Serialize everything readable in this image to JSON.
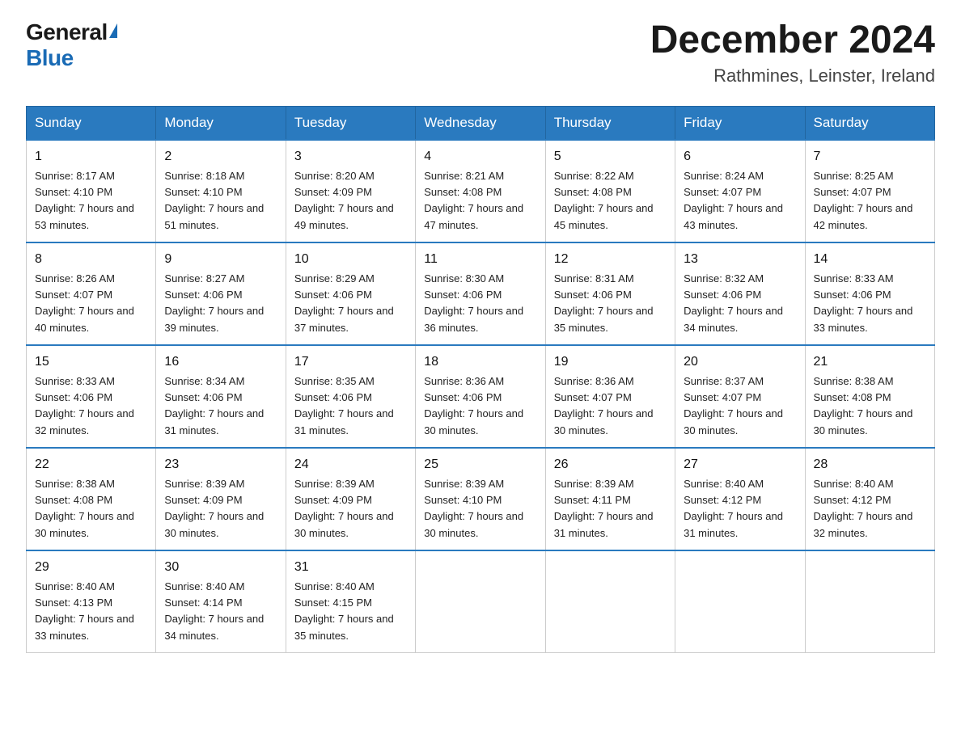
{
  "header": {
    "logo_general": "General",
    "logo_blue": "Blue",
    "month_title": "December 2024",
    "subtitle": "Rathmines, Leinster, Ireland"
  },
  "calendar": {
    "days_of_week": [
      "Sunday",
      "Monday",
      "Tuesday",
      "Wednesday",
      "Thursday",
      "Friday",
      "Saturday"
    ],
    "weeks": [
      [
        {
          "day": "1",
          "sunrise": "8:17 AM",
          "sunset": "4:10 PM",
          "daylight": "7 hours and 53 minutes."
        },
        {
          "day": "2",
          "sunrise": "8:18 AM",
          "sunset": "4:10 PM",
          "daylight": "7 hours and 51 minutes."
        },
        {
          "day": "3",
          "sunrise": "8:20 AM",
          "sunset": "4:09 PM",
          "daylight": "7 hours and 49 minutes."
        },
        {
          "day": "4",
          "sunrise": "8:21 AM",
          "sunset": "4:08 PM",
          "daylight": "7 hours and 47 minutes."
        },
        {
          "day": "5",
          "sunrise": "8:22 AM",
          "sunset": "4:08 PM",
          "daylight": "7 hours and 45 minutes."
        },
        {
          "day": "6",
          "sunrise": "8:24 AM",
          "sunset": "4:07 PM",
          "daylight": "7 hours and 43 minutes."
        },
        {
          "day": "7",
          "sunrise": "8:25 AM",
          "sunset": "4:07 PM",
          "daylight": "7 hours and 42 minutes."
        }
      ],
      [
        {
          "day": "8",
          "sunrise": "8:26 AM",
          "sunset": "4:07 PM",
          "daylight": "7 hours and 40 minutes."
        },
        {
          "day": "9",
          "sunrise": "8:27 AM",
          "sunset": "4:06 PM",
          "daylight": "7 hours and 39 minutes."
        },
        {
          "day": "10",
          "sunrise": "8:29 AM",
          "sunset": "4:06 PM",
          "daylight": "7 hours and 37 minutes."
        },
        {
          "day": "11",
          "sunrise": "8:30 AM",
          "sunset": "4:06 PM",
          "daylight": "7 hours and 36 minutes."
        },
        {
          "day": "12",
          "sunrise": "8:31 AM",
          "sunset": "4:06 PM",
          "daylight": "7 hours and 35 minutes."
        },
        {
          "day": "13",
          "sunrise": "8:32 AM",
          "sunset": "4:06 PM",
          "daylight": "7 hours and 34 minutes."
        },
        {
          "day": "14",
          "sunrise": "8:33 AM",
          "sunset": "4:06 PM",
          "daylight": "7 hours and 33 minutes."
        }
      ],
      [
        {
          "day": "15",
          "sunrise": "8:33 AM",
          "sunset": "4:06 PM",
          "daylight": "7 hours and 32 minutes."
        },
        {
          "day": "16",
          "sunrise": "8:34 AM",
          "sunset": "4:06 PM",
          "daylight": "7 hours and 31 minutes."
        },
        {
          "day": "17",
          "sunrise": "8:35 AM",
          "sunset": "4:06 PM",
          "daylight": "7 hours and 31 minutes."
        },
        {
          "day": "18",
          "sunrise": "8:36 AM",
          "sunset": "4:06 PM",
          "daylight": "7 hours and 30 minutes."
        },
        {
          "day": "19",
          "sunrise": "8:36 AM",
          "sunset": "4:07 PM",
          "daylight": "7 hours and 30 minutes."
        },
        {
          "day": "20",
          "sunrise": "8:37 AM",
          "sunset": "4:07 PM",
          "daylight": "7 hours and 30 minutes."
        },
        {
          "day": "21",
          "sunrise": "8:38 AM",
          "sunset": "4:08 PM",
          "daylight": "7 hours and 30 minutes."
        }
      ],
      [
        {
          "day": "22",
          "sunrise": "8:38 AM",
          "sunset": "4:08 PM",
          "daylight": "7 hours and 30 minutes."
        },
        {
          "day": "23",
          "sunrise": "8:39 AM",
          "sunset": "4:09 PM",
          "daylight": "7 hours and 30 minutes."
        },
        {
          "day": "24",
          "sunrise": "8:39 AM",
          "sunset": "4:09 PM",
          "daylight": "7 hours and 30 minutes."
        },
        {
          "day": "25",
          "sunrise": "8:39 AM",
          "sunset": "4:10 PM",
          "daylight": "7 hours and 30 minutes."
        },
        {
          "day": "26",
          "sunrise": "8:39 AM",
          "sunset": "4:11 PM",
          "daylight": "7 hours and 31 minutes."
        },
        {
          "day": "27",
          "sunrise": "8:40 AM",
          "sunset": "4:12 PM",
          "daylight": "7 hours and 31 minutes."
        },
        {
          "day": "28",
          "sunrise": "8:40 AM",
          "sunset": "4:12 PM",
          "daylight": "7 hours and 32 minutes."
        }
      ],
      [
        {
          "day": "29",
          "sunrise": "8:40 AM",
          "sunset": "4:13 PM",
          "daylight": "7 hours and 33 minutes."
        },
        {
          "day": "30",
          "sunrise": "8:40 AM",
          "sunset": "4:14 PM",
          "daylight": "7 hours and 34 minutes."
        },
        {
          "day": "31",
          "sunrise": "8:40 AM",
          "sunset": "4:15 PM",
          "daylight": "7 hours and 35 minutes."
        },
        null,
        null,
        null,
        null
      ]
    ]
  }
}
